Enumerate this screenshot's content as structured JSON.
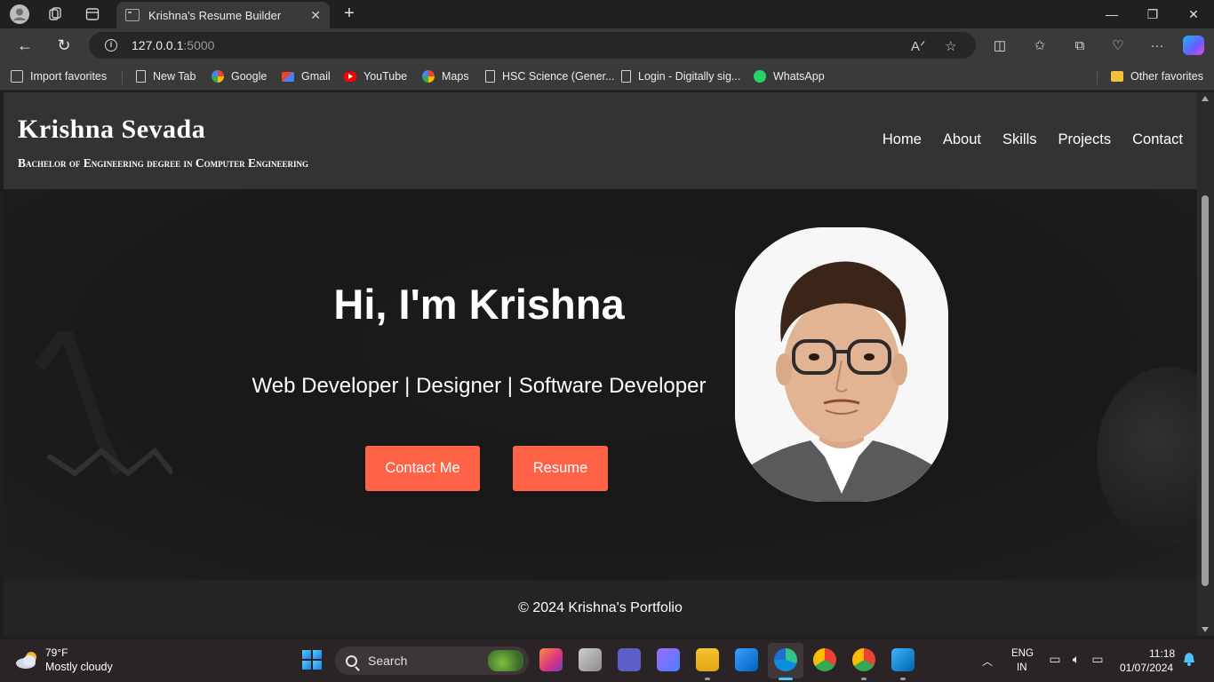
{
  "browser": {
    "tab_title": "Krishna's Resume Builder",
    "url_host": "127.0.0.1",
    "url_port": ":5000",
    "favorites": [
      {
        "label": "Import favorites",
        "icon": "import-icon"
      },
      {
        "label": "New Tab",
        "icon": "page-icon"
      },
      {
        "label": "Google",
        "icon": "google-icon"
      },
      {
        "label": "Gmail",
        "icon": "gmail-icon"
      },
      {
        "label": "YouTube",
        "icon": "youtube-icon"
      },
      {
        "label": "Maps",
        "icon": "google-icon"
      },
      {
        "label": "HSC Science (Gener...",
        "icon": "page-icon"
      },
      {
        "label": "Login - Digitally sig...",
        "icon": "page-icon"
      },
      {
        "label": "WhatsApp",
        "icon": "whatsapp-icon"
      }
    ],
    "other_favorites": "Other favorites"
  },
  "site": {
    "name": "Krishna Sevada",
    "tagline": "Bachelor of Engineering degree in Computer Engineering",
    "nav": [
      "Home",
      "About",
      "Skills",
      "Projects",
      "Contact"
    ],
    "hero": {
      "title": "Hi, I'm Krishna",
      "subtitle": "Web Developer | Designer | Software Developer",
      "contact_button": "Contact Me",
      "resume_button": "Resume",
      "accent_color": "#ff6347"
    },
    "footer": "© 2024 Krishna's Portfolio"
  },
  "taskbar": {
    "weather_temp": "79°F",
    "weather_desc": "Mostly cloudy",
    "search_label": "Search",
    "lang_line1": "ENG",
    "lang_line2": "IN",
    "time": "11:18",
    "date": "01/07/2024"
  }
}
